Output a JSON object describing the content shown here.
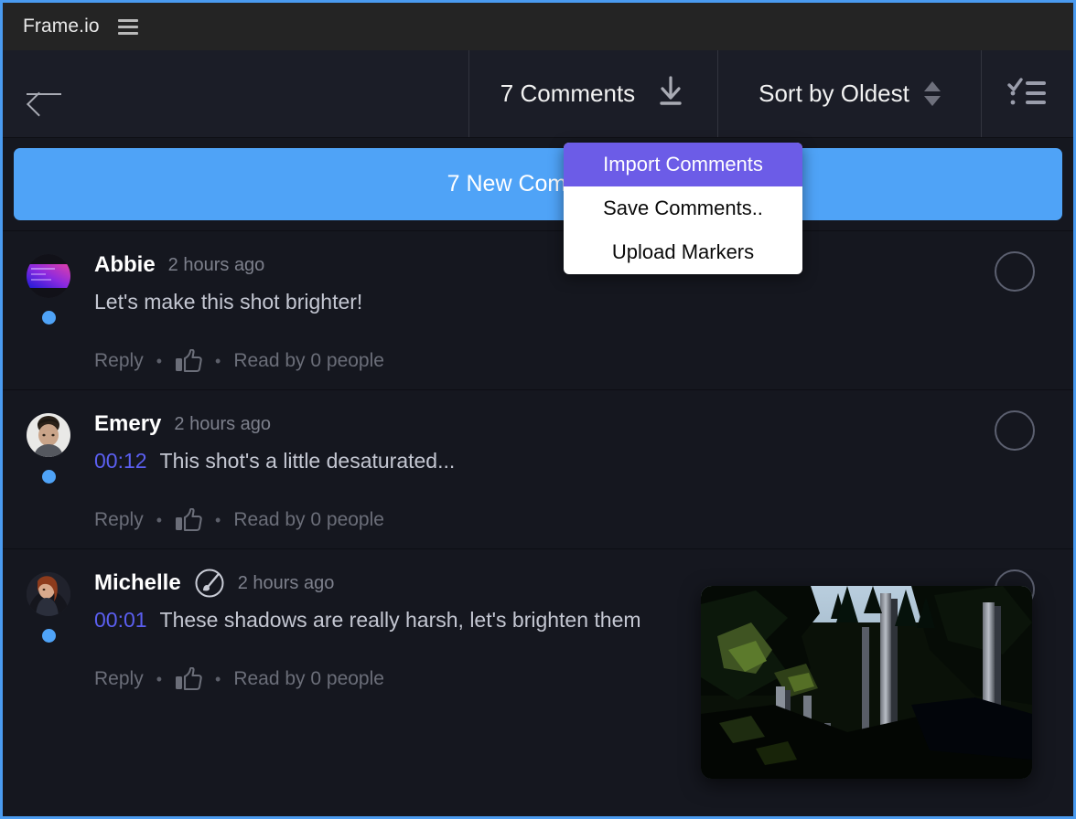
{
  "window": {
    "brand": "Frame.io",
    "menu_icon": "hamburger-icon",
    "accent_border": "#4a9bf0"
  },
  "toolbar": {
    "back_icon": "arrow-left-icon",
    "comments_count_label": "7 Comments",
    "download_icon": "download-icon",
    "sort_label": "Sort by Oldest",
    "sort_spinner_icon": "chevron-updown-icon",
    "list_icon": "checklist-icon"
  },
  "banner": {
    "label": "7 New Comments",
    "color": "#4fa3f7"
  },
  "dropdown": {
    "visible": true,
    "highlight_color": "#6c5ce7",
    "items": [
      {
        "label": "Import Comments",
        "active": true
      },
      {
        "label": "Save Comments..",
        "active": false
      },
      {
        "label": "Upload Markers",
        "active": false
      }
    ]
  },
  "comments": {
    "action_reply": "Reply",
    "action_sep": "•",
    "like_icon": "thumbs-up-icon",
    "timestamp_color": "#5b5ff0",
    "items": [
      {
        "author": "Abbie",
        "time": "2 hours ago",
        "timecode": "",
        "text": "Let's make this shot brighter!",
        "read_by": "Read by 0 people",
        "badge": "",
        "avatar_kind": "gradient-purple",
        "unread": true,
        "checkbox": "unchecked"
      },
      {
        "author": "Emery",
        "time": "2 hours ago",
        "timecode": "00:12",
        "text": "This shot's a little desaturated...",
        "read_by": "Read by 0 people",
        "badge": "",
        "avatar_kind": "photo-man",
        "unread": true,
        "checkbox": "unchecked"
      },
      {
        "author": "Michelle",
        "time": "2 hours ago",
        "timecode": "00:01",
        "text": "These shadows are really harsh, let's brighten them",
        "read_by": "Read by 0 people",
        "badge": "brush-annotation-icon",
        "avatar_kind": "photo-woman",
        "unread": true,
        "checkbox": "unchecked"
      }
    ]
  },
  "thumbnail": {
    "name": "forest-frame-thumbnail",
    "description": "dark forest with tall tree trunks"
  }
}
